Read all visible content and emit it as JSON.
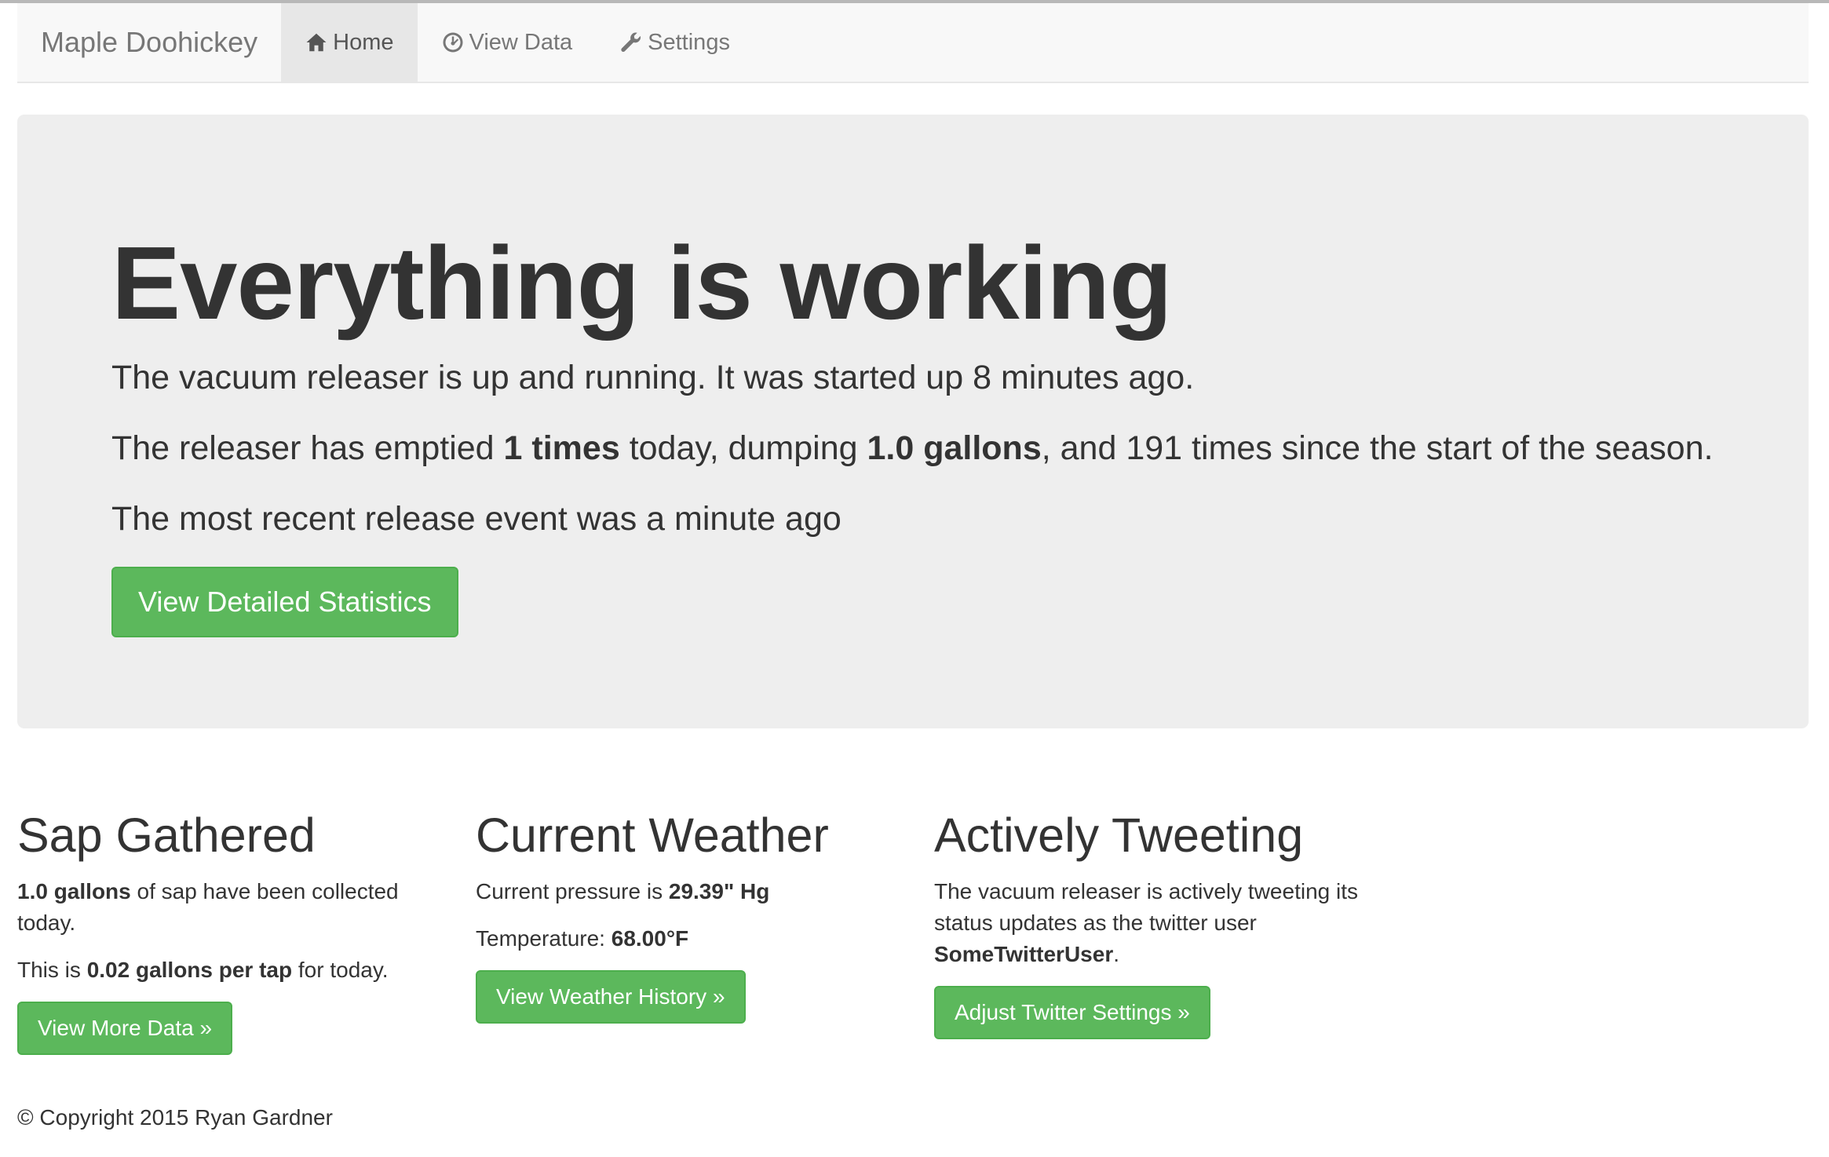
{
  "navbar": {
    "brand": "Maple Doohickey",
    "items": [
      {
        "label": "Home",
        "icon": "home-icon",
        "active": true
      },
      {
        "label": "View Data",
        "icon": "dashboard-icon",
        "active": false
      },
      {
        "label": "Settings",
        "icon": "wrench-icon",
        "active": false
      }
    ]
  },
  "jumbotron": {
    "title": "Everything is working",
    "line1": "The vacuum releaser is up and running. It was started up 8 minutes ago.",
    "line2": {
      "prefix": "The releaser has emptied ",
      "times_today": "1 times",
      "mid1": " today, dumping ",
      "gallons": "1.0 gallons",
      "suffix": ", and 191 times since the start of the season."
    },
    "line3": "The most recent release event was a minute ago",
    "button_label": "View Detailed Statistics"
  },
  "sap": {
    "title": "Sap Gathered",
    "p1_bold": "1.0 gallons",
    "p1_rest": " of sap have been collected today.",
    "p2_prefix": "This is ",
    "p2_bold": "0.02 gallons per tap",
    "p2_suffix": " for today.",
    "button_label": "View More Data »"
  },
  "weather": {
    "title": "Current Weather",
    "p1_prefix": "Current pressure is ",
    "p1_bold": "29.39\" Hg",
    "p2_prefix": "Temperature: ",
    "p2_bold": "68.00°F",
    "button_label": "View Weather History »"
  },
  "twitter": {
    "title": "Actively Tweeting",
    "p1_prefix": "The vacuum releaser is actively tweeting its status updates as the twitter user ",
    "p1_bold": "SomeTwitterUser",
    "p1_suffix": ".",
    "button_label": "Adjust Twitter Settings »"
  },
  "footer": {
    "text": "© Copyright 2015 Ryan Gardner"
  },
  "colors": {
    "success": "#5cb85c",
    "jumbotron_bg": "#eeeeee",
    "navbar_bg": "#f8f8f8"
  }
}
